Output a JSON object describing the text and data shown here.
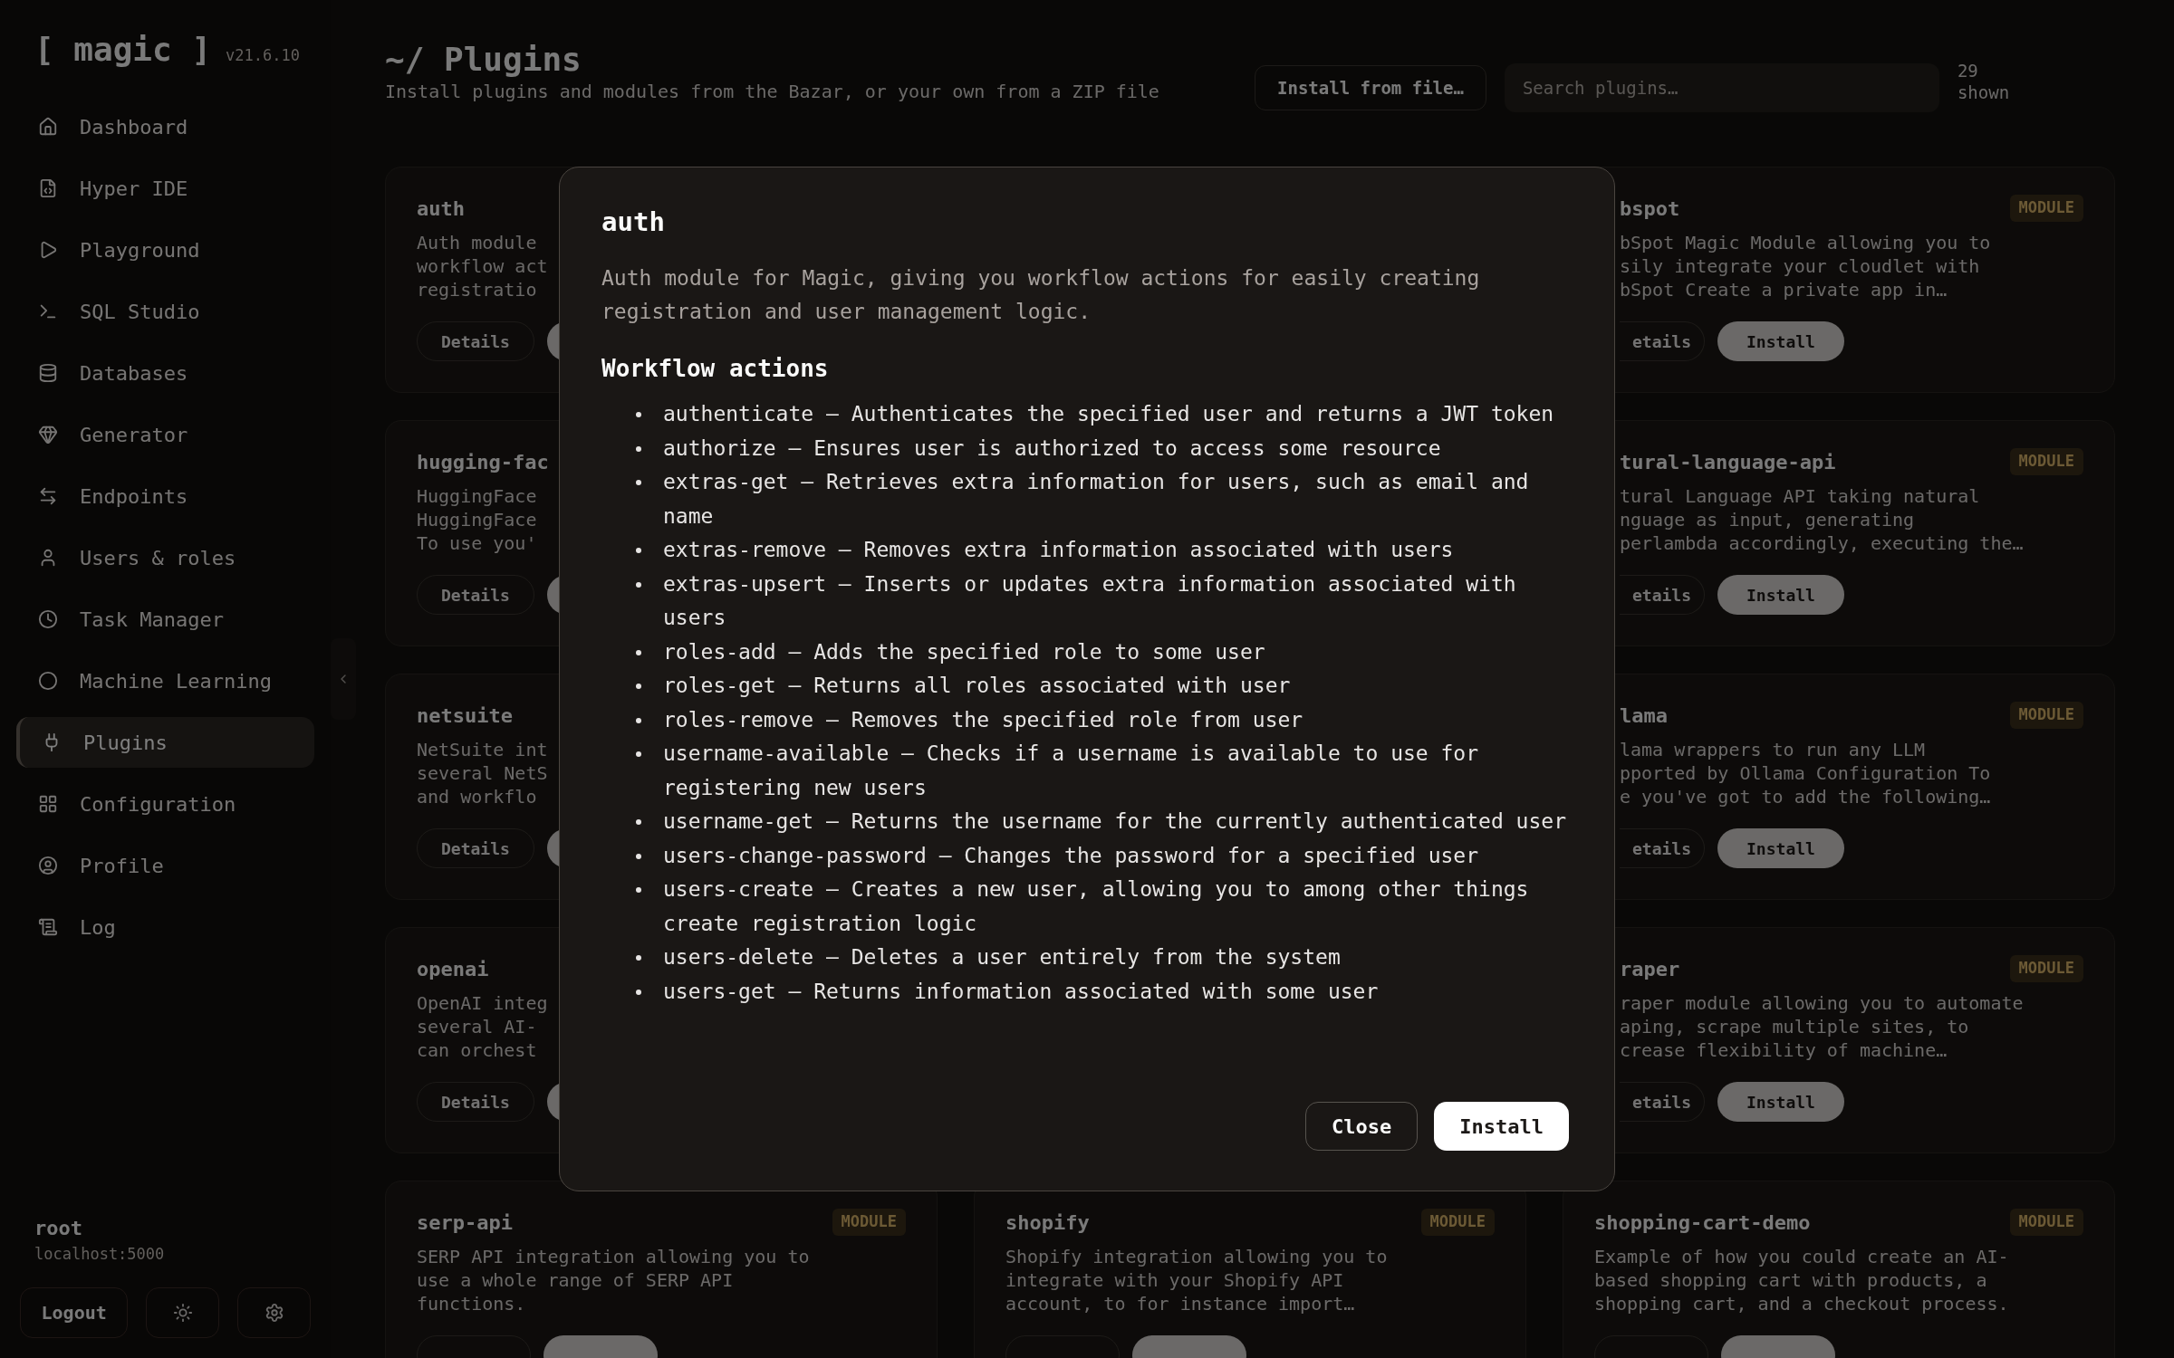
{
  "sidebar": {
    "logo": "[ magic ]",
    "version": "v21.6.10",
    "items": [
      {
        "label": "Dashboard",
        "selected": false
      },
      {
        "label": "Hyper IDE",
        "selected": false
      },
      {
        "label": "Playground",
        "selected": false
      },
      {
        "label": "SQL Studio",
        "selected": false
      },
      {
        "label": "Databases",
        "selected": false
      },
      {
        "label": "Generator",
        "selected": false
      },
      {
        "label": "Endpoints",
        "selected": false
      },
      {
        "label": "Users & roles",
        "selected": false
      },
      {
        "label": "Task Manager",
        "selected": false
      },
      {
        "label": "Machine Learning",
        "selected": false
      },
      {
        "label": "Plugins",
        "selected": true
      },
      {
        "label": "Configuration",
        "selected": false
      },
      {
        "label": "Profile",
        "selected": false
      },
      {
        "label": "Log",
        "selected": false
      }
    ],
    "user": {
      "name": "root",
      "host": "localhost:5000"
    },
    "logout": "Logout"
  },
  "header": {
    "title": "~/ Plugins",
    "subtitle": "Install plugins and modules from the Bazar, or your own from a ZIP file",
    "install_from_file": "Install from file…",
    "search": {
      "placeholder": "Search plugins…"
    },
    "count": "29 shown"
  },
  "left_column": [
    {
      "name": "auth",
      "lines": [
        "Auth module",
        "workflow act",
        "registratio"
      ],
      "details": "Details"
    },
    {
      "name": "hugging-fac",
      "lines": [
        "HuggingFace",
        "HuggingFace",
        "To use you'"
      ],
      "details": "Details"
    },
    {
      "name": "netsuite",
      "lines": [
        "NetSuite int",
        "several NetS",
        "and workflo"
      ],
      "details": "Details"
    },
    {
      "name": "openai",
      "lines": [
        "OpenAI integ",
        "several AI-",
        "can orchest"
      ],
      "details": "Details"
    }
  ],
  "right_column": [
    {
      "name": "bspot",
      "badge": "MODULE",
      "lines": [
        "bSpot Magic Module allowing you to",
        "sily integrate your cloudlet with",
        "bSpot Create a private app in…"
      ],
      "details": "etails",
      "install": "Install"
    },
    {
      "name": "tural-language-api",
      "badge": "MODULE",
      "lines": [
        "tural Language API taking natural",
        "nguage as input, generating",
        "perlambda accordingly, executing the…"
      ],
      "details": "etails",
      "install": "Install"
    },
    {
      "name": "lama",
      "badge": "MODULE",
      "lines": [
        "lama wrappers to run any LLM",
        "pported by Ollama Configuration To",
        "e you've got to add the following…"
      ],
      "details": "etails",
      "install": "Install"
    },
    {
      "name": "raper",
      "badge": "MODULE",
      "lines": [
        "raper module allowing you to automate",
        "aping, scrape multiple sites, to",
        "crease flexibility of machine…"
      ],
      "details": "etails",
      "install": "Install"
    }
  ],
  "bottom_row": [
    {
      "name": "serp-api",
      "badge": "MODULE",
      "lines": [
        "SERP API integration allowing you to",
        "use a whole range of SERP API",
        "functions."
      ]
    },
    {
      "name": "shopify",
      "badge": "MODULE",
      "lines": [
        "Shopify integration allowing you to",
        "integrate with your Shopify API",
        "account, to for instance import…"
      ]
    },
    {
      "name": "shopping-cart-demo",
      "badge": "MODULE",
      "lines": [
        "Example of how you could create an AI-",
        "based shopping cart with products, a",
        "shopping cart, and a checkout process."
      ]
    }
  ],
  "dialog": {
    "title": "auth",
    "description": "Auth module for Magic, giving you workflow actions for easily creating registration and user management logic.",
    "section": "Workflow actions",
    "actions": [
      "authenticate – Authenticates the specified user and returns a JWT token",
      "authorize – Ensures user is authorized to access some resource",
      "extras-get – Retrieves extra information for users, such as email and name",
      "extras-remove – Removes extra information associated with users",
      "extras-upsert – Inserts or updates extra information associated with users",
      "roles-add – Adds the specified role to some user",
      "roles-get – Returns all roles associated with user",
      "roles-remove – Removes the specified role from user",
      "username-available – Checks if a username is available to use for registering new users",
      "username-get – Returns the username for the currently authenticated user",
      "users-change-password – Changes the password for a specified user",
      "users-create – Creates a new user, allowing you to among other things create registration logic",
      "users-delete – Deletes a user entirely from the system",
      "users-get – Returns information associated with some user"
    ],
    "close": "Close",
    "install": "Install"
  }
}
